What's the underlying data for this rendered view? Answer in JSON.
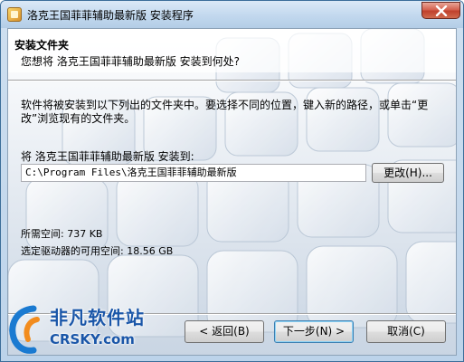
{
  "window": {
    "title": "洛克王国菲菲辅助最新版 安装程序",
    "icon": "installer-icon",
    "close_icon": "close-icon"
  },
  "header": {
    "title": "安装文件夹",
    "subtitle": "您想将 洛克王国菲菲辅助最新版 安装到何处?"
  },
  "body": {
    "description": "软件将被安装到以下列出的文件夹中。要选择不同的位置，键入新的路径，或单击“更改”浏览现有的文件夹。",
    "install_label": "将 洛克王国菲菲辅助最新版 安装到:",
    "install_path": "C:\\Program Files\\洛克王国菲菲辅助最新版",
    "browse_button": "更改(H)...",
    "space_required": "所需空间: 737 KB",
    "space_available": "选定驱动器的可用空间: 18.56 GB"
  },
  "footer": {
    "back_button": "< 返回(B)",
    "next_button": "下一步(N) >",
    "cancel_button": "取消(C)"
  },
  "watermark": {
    "name_cn": "非凡软件站",
    "name_en": "CRSKY.com"
  },
  "colors": {
    "title_bar": "#c2d8ee",
    "close_button": "#c7412c",
    "default_button_border": "#3c7fb1",
    "watermark": "#1a56a8"
  }
}
